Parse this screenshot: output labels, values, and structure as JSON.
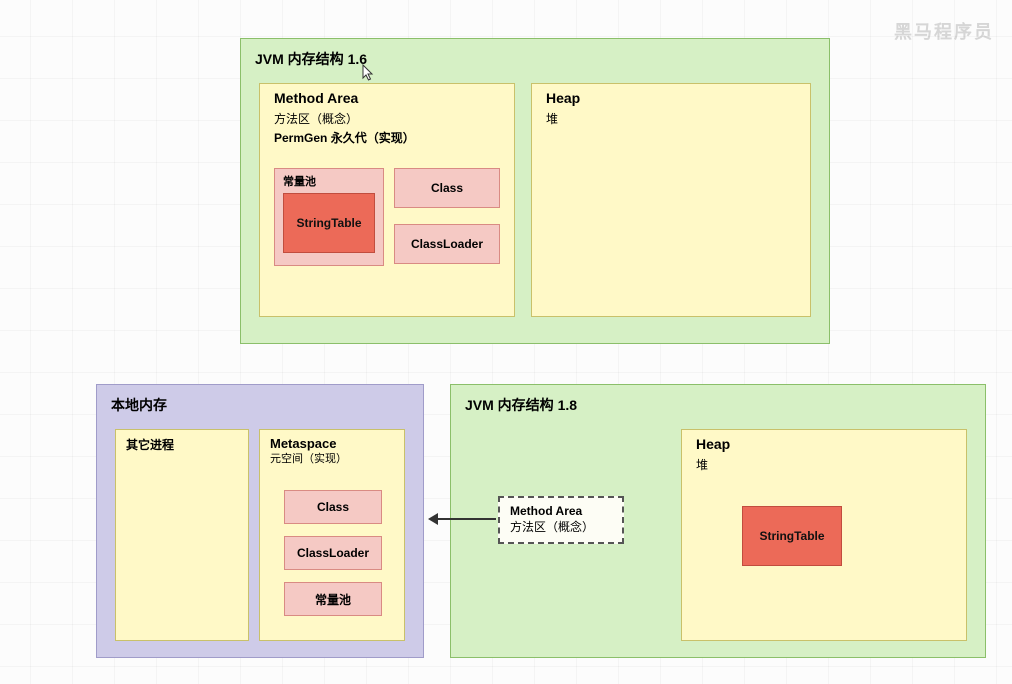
{
  "watermark": "黑马程序员",
  "jvm16": {
    "title": "JVM 内存结构 1.6",
    "method_area": {
      "title": "Method Area",
      "sub1": "方法区（概念）",
      "sub2": "PermGen 永久代（实现）",
      "const_pool": "常量池",
      "string_table": "StringTable",
      "class_box": "Class",
      "classloader_box": "ClassLoader"
    },
    "heap": {
      "title": "Heap",
      "sub": "堆"
    }
  },
  "native": {
    "title": "本地内存",
    "other_process": "其它进程",
    "metaspace": {
      "title": "Metaspace",
      "sub": "元空间（实现）",
      "class_box": "Class",
      "classloader_box": "ClassLoader",
      "const_pool": "常量池"
    }
  },
  "jvm18": {
    "title": "JVM 内存结构 1.8",
    "method_area": {
      "title": "Method Area",
      "sub": "方法区（概念）"
    },
    "heap": {
      "title": "Heap",
      "sub": "堆",
      "string_table": "StringTable"
    }
  }
}
